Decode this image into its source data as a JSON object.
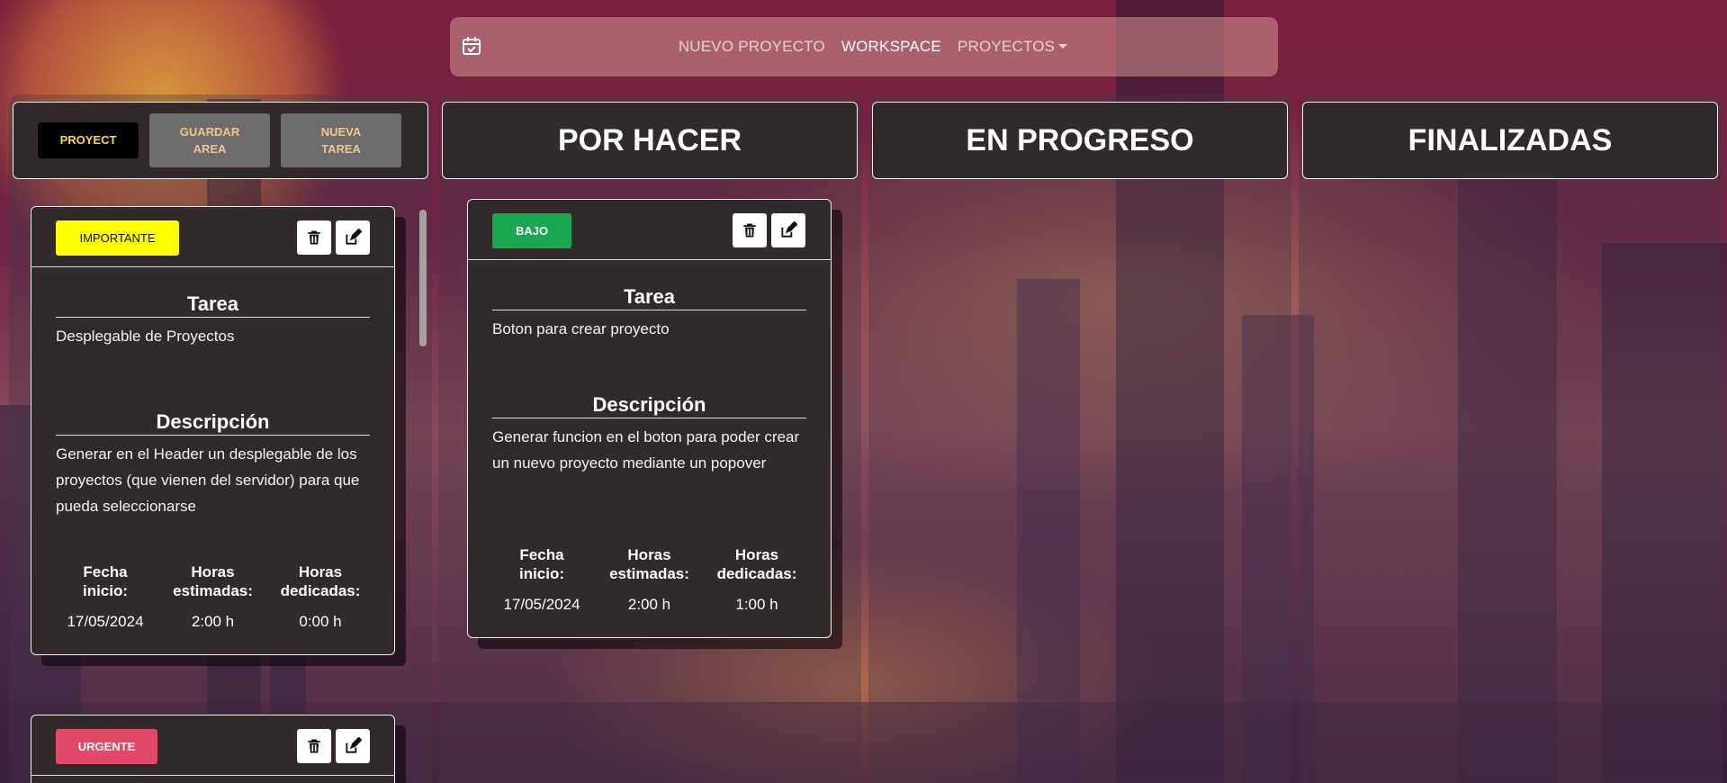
{
  "nav": {
    "brand_icon": "calendar-check-icon",
    "links": [
      "NUEVO PROYECTO",
      "WORKSPACE",
      "PROYECTOS"
    ]
  },
  "tools": {
    "proyect": "PROYECT",
    "guardar_area": "GUARDAR AREA",
    "nueva_tarea": "NUEVA TAREA"
  },
  "columns": {
    "todo": "POR HACER",
    "in_progress": "EN PROGRESO",
    "done": "FINALIZADAS"
  },
  "labels": {
    "tarea": "Tarea",
    "descripcion": "Descripción",
    "fecha_inicio": "Fecha inicio:",
    "horas_estimadas": "Horas estimadas:",
    "horas_dedicadas": "Horas dedicadas:"
  },
  "cards": [
    {
      "priority": "IMPORTANTE",
      "task": "Desplegable de Proyectos",
      "description": "Generar en el Header un desplegable de los proyectos (que vienen del servidor) para que pueda seleccionarse",
      "start_date": "17/05/2024",
      "estimated": "2:00 h",
      "dedicated": "0:00 h"
    },
    {
      "priority": "BAJO",
      "task": "Boton para crear proyecto",
      "description": "Generar funcion en el boton para poder crear un nuevo proyecto mediante un popover",
      "start_date": "17/05/2024",
      "estimated": "2:00 h",
      "dedicated": "1:00 h"
    },
    {
      "priority": "URGENTE"
    }
  ],
  "icons": {
    "delete": "trash-icon",
    "edit": "edit-icon"
  },
  "colors": {
    "importante": "#ffff00",
    "bajo": "#19a84e",
    "urgente": "#e04a68",
    "card_bg": "#302a2a"
  }
}
